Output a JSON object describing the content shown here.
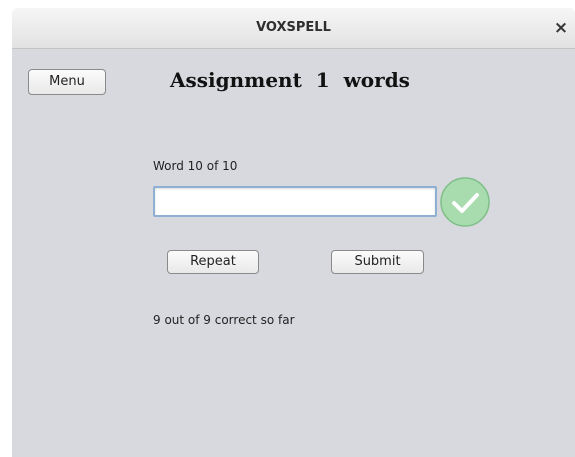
{
  "window": {
    "title": "VOXSPELL",
    "close_label": "×"
  },
  "toolbar": {
    "menu_label": "Menu"
  },
  "main": {
    "heading": "Assignment  1  words",
    "word_counter": "Word 10 of 10",
    "answer_input": {
      "value": "",
      "placeholder": ""
    },
    "status_icon": "checkmark-icon",
    "repeat_label": "Repeat",
    "submit_label": "Submit",
    "score_text": "9 out of 9 correct so far"
  },
  "colors": {
    "background": "#d7d9df",
    "check_fill": "#a8dcae",
    "check_border": "#7fbf87",
    "input_border": "#8fb0d4"
  }
}
